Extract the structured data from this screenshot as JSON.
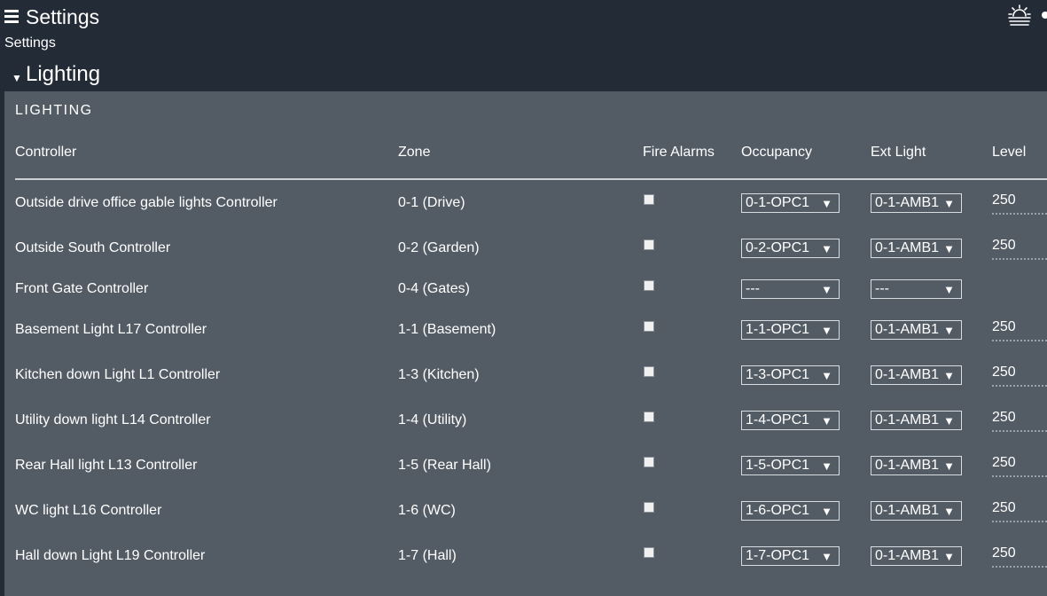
{
  "header": {
    "title": "Settings",
    "breadcrumb": "Settings",
    "icons": [
      "menu-icon",
      "sunrise-icon"
    ]
  },
  "section": {
    "title": "Lighting",
    "panel_title": "LIGHTING"
  },
  "table": {
    "columns": [
      "Controller",
      "Zone",
      "Fire Alarms",
      "Occupancy",
      "Ext Light",
      "Level"
    ],
    "rows": [
      {
        "controller": "Outside drive office gable lights Controller",
        "zone": "0-1 (Drive)",
        "fire_alarm": false,
        "occupancy": "0-1-OPC1",
        "ext_light": "0-1-AMB1",
        "level": "250"
      },
      {
        "controller": "Outside South Controller",
        "zone": "0-2 (Garden)",
        "fire_alarm": false,
        "occupancy": "0-2-OPC1",
        "ext_light": "0-1-AMB1",
        "level": "250"
      },
      {
        "controller": "Front Gate Controller",
        "zone": "0-4 (Gates)",
        "fire_alarm": false,
        "occupancy": "---",
        "ext_light": "---",
        "level": ""
      },
      {
        "controller": "Basement Light L17 Controller",
        "zone": "1-1 (Basement)",
        "fire_alarm": false,
        "occupancy": "1-1-OPC1",
        "ext_light": "0-1-AMB1",
        "level": "250"
      },
      {
        "controller": "Kitchen down Light L1 Controller",
        "zone": "1-3 (Kitchen)",
        "fire_alarm": false,
        "occupancy": "1-3-OPC1",
        "ext_light": "0-1-AMB1",
        "level": "250"
      },
      {
        "controller": "Utility down light L14 Controller",
        "zone": "1-4 (Utility)",
        "fire_alarm": false,
        "occupancy": "1-4-OPC1",
        "ext_light": "0-1-AMB1",
        "level": "250"
      },
      {
        "controller": "Rear Hall light L13 Controller",
        "zone": "1-5 (Rear Hall)",
        "fire_alarm": false,
        "occupancy": "1-5-OPC1",
        "ext_light": "0-1-AMB1",
        "level": "250"
      },
      {
        "controller": "WC light L16 Controller",
        "zone": "1-6 (WC)",
        "fire_alarm": false,
        "occupancy": "1-6-OPC1",
        "ext_light": "0-1-AMB1",
        "level": "250"
      },
      {
        "controller": "Hall down Light L19 Controller",
        "zone": "1-7 (Hall)",
        "fire_alarm": false,
        "occupancy": "1-7-OPC1",
        "ext_light": "0-1-AMB1",
        "level": "250"
      }
    ]
  },
  "colors": {
    "background": "#232c36",
    "panel": "#535c65",
    "text": "#ffffff"
  }
}
